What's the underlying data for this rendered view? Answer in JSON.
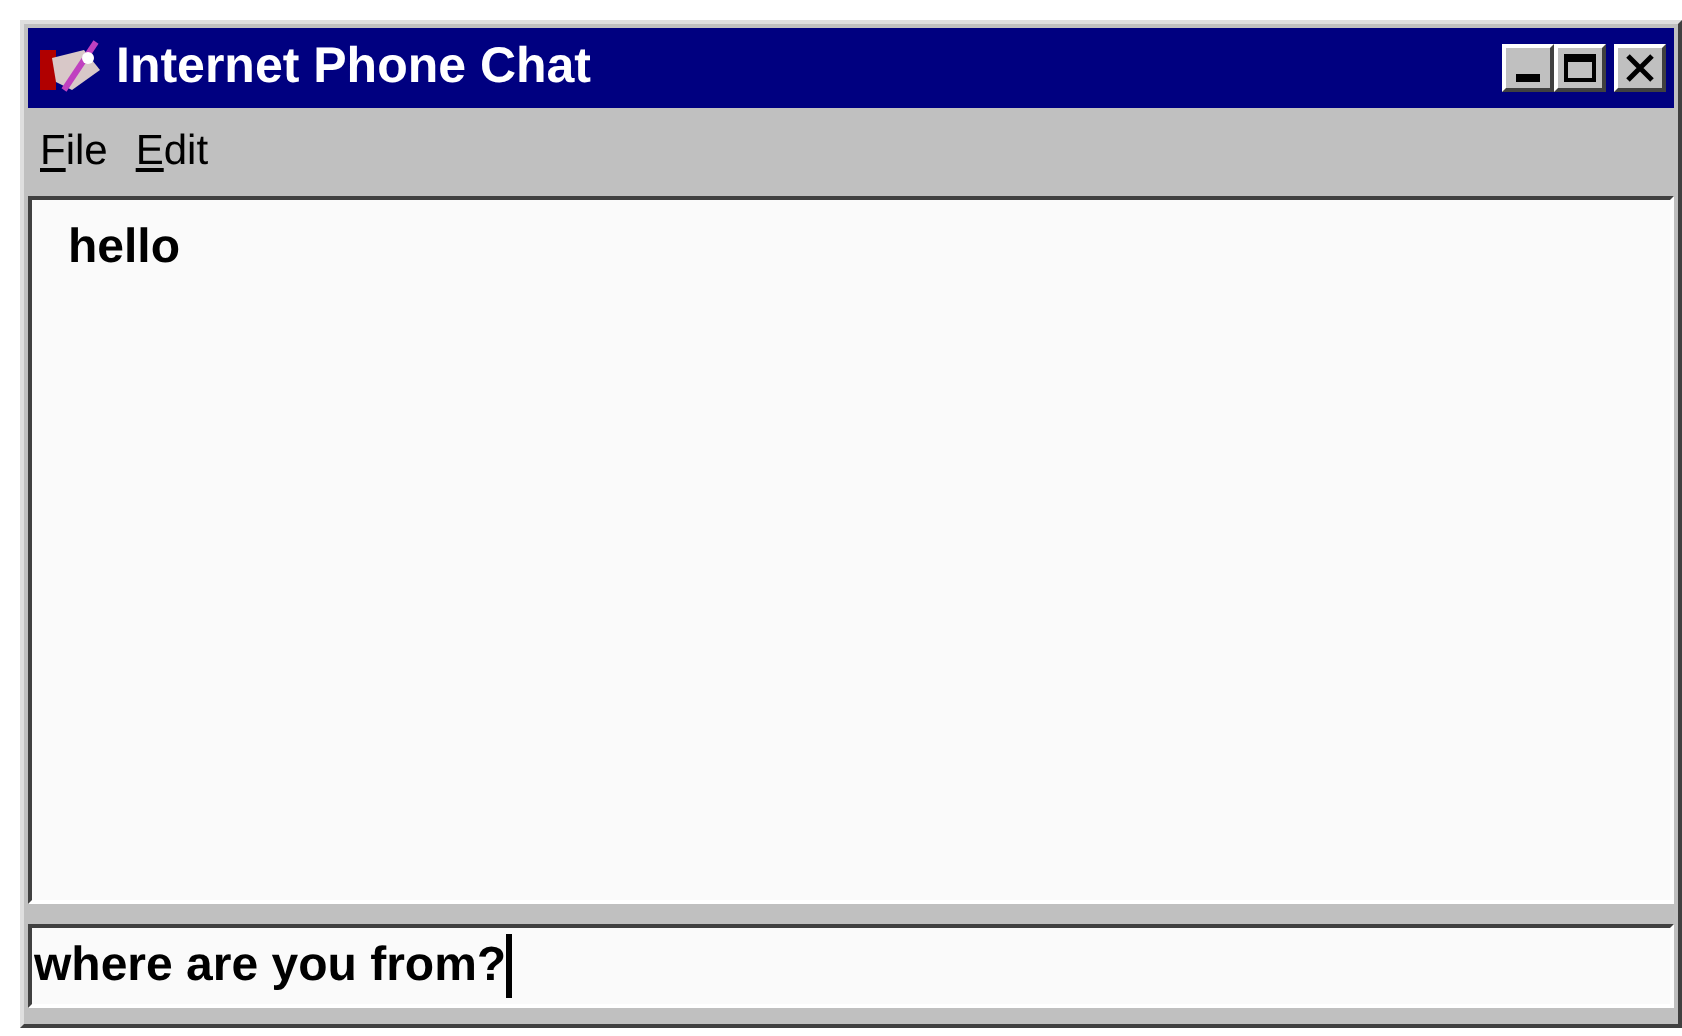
{
  "window": {
    "title": "Internet Phone Chat"
  },
  "menu": [
    {
      "label": "File"
    },
    {
      "label": "Edit"
    }
  ],
  "chat": {
    "messages": [
      "hello"
    ]
  },
  "input": {
    "value": "where are you from?"
  }
}
